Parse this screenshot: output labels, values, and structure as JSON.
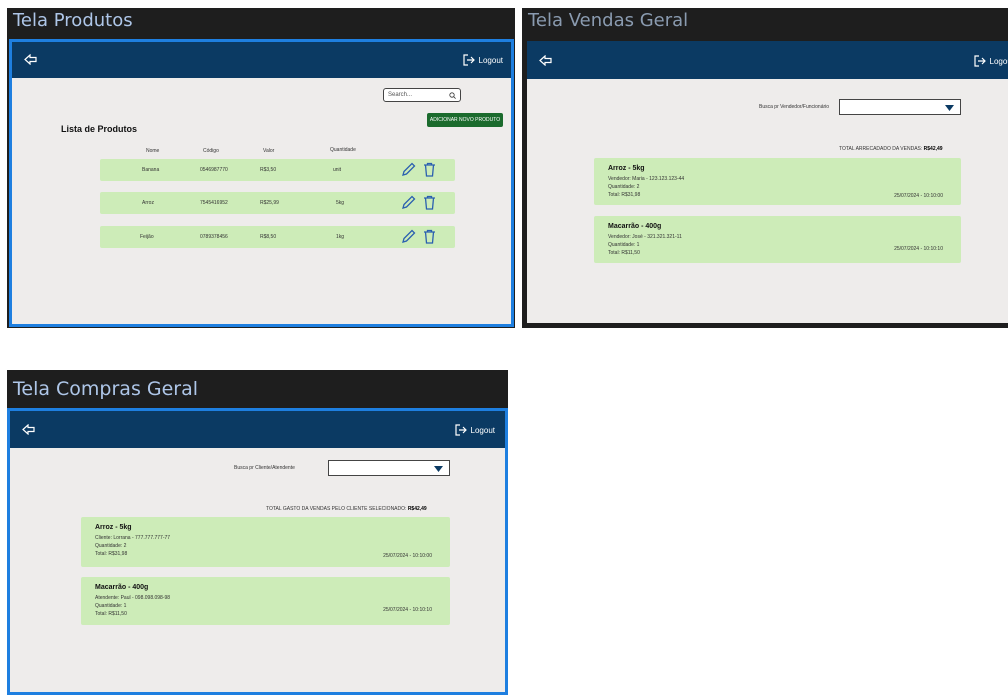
{
  "produtos": {
    "window_title": "Tela Produtos",
    "logout_label": "Logout",
    "search_placeholder": "Search...",
    "add_button": "ADICIONAR NOVO PRODUTO",
    "list_title": "Lista de Produtos",
    "columns": [
      "Nome",
      "Código",
      "Valor",
      "Quantidade"
    ],
    "rows": [
      {
        "nome": "Banana",
        "codigo": "0546987770",
        "valor": "R$3,50",
        "quantidade": "unit"
      },
      {
        "nome": "Arroz",
        "codigo": "7545416952",
        "valor": "R$25,99",
        "quantidade": "5kg"
      },
      {
        "nome": "Feijão",
        "codigo": "0789378456",
        "valor": "R$8,50",
        "quantidade": "1kg"
      }
    ]
  },
  "vendas": {
    "window_title": "Tela Vendas Geral",
    "logout_label": "Logout",
    "filter_label": "Busca pr Vendedor/Funcionário",
    "total_label": "TOTAL ARRECADADO DA VENDAS:",
    "total_value": "R$42,49",
    "cards": [
      {
        "title": "Arroz - 5kg",
        "person": "Vendedor: Maria - 123.123.123-44",
        "quantidade": "Quantidade: 2",
        "total": "Total: R$31,98",
        "date": "25/07/2024 - 10:10:00"
      },
      {
        "title": "Macarrão - 400g",
        "person": "Vendedor: José - 321.321.321-11",
        "quantidade": "Quantidade: 1",
        "total": "Total: R$11,50",
        "date": "25/07/2024 - 10:10:10"
      }
    ]
  },
  "compras": {
    "window_title": "Tela Compras Geral",
    "logout_label": "Logout",
    "filter_label": "Busca pr Cliente/Atendente",
    "total_label": "TOTAL GASTO DA VENDAS PELO CLIENTE SELECIONADO:",
    "total_value": "R$42,49",
    "cards": [
      {
        "title": "Arroz - 5kg",
        "person": "Cliente: Lorrana - 777.777.777-77",
        "quantidade": "Quantidade: 2",
        "total": "Total: R$31,98",
        "date": "25/07/2024 - 10:10:00"
      },
      {
        "title": "Macarrão - 400g",
        "person": "Atendente: Paul - 098.098.098-98",
        "quantidade": "Quantidade: 1",
        "total": "Total: R$11,50",
        "date": "25/07/2024 - 10:10:10"
      }
    ]
  },
  "colors": {
    "topbar": "#0b3a63",
    "row_green": "#cdecb8",
    "add_button": "#1b6b2d",
    "selection": "#1e7fe0",
    "icon_blue": "#2a5fb0"
  }
}
